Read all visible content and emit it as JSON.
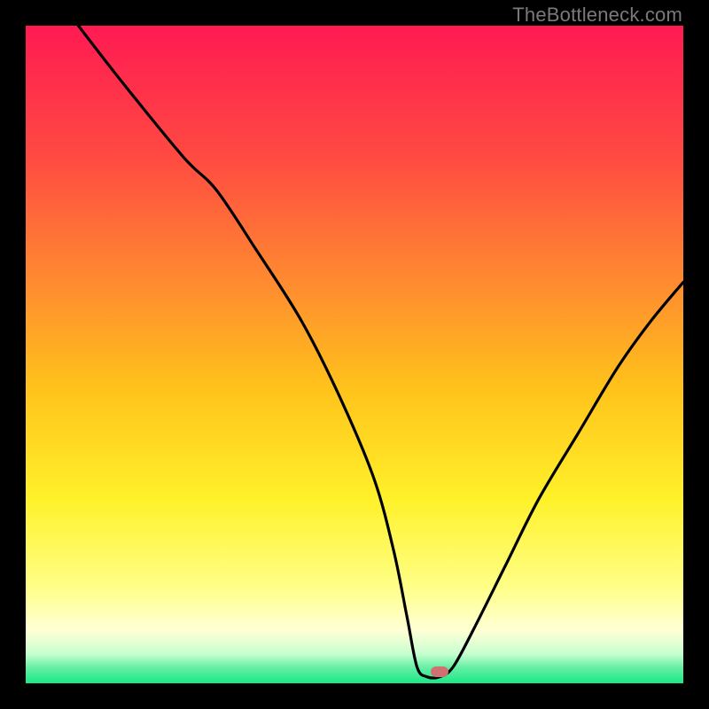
{
  "watermark": "TheBottleneck.com",
  "chart_data": {
    "type": "line",
    "title": "",
    "xlabel": "",
    "ylabel": "",
    "xlim": [
      0,
      100
    ],
    "ylim": [
      0,
      100
    ],
    "grid": false,
    "gradient_stops": [
      {
        "pos": 0.0,
        "color": "#ff1a52"
      },
      {
        "pos": 0.2,
        "color": "#ff4a42"
      },
      {
        "pos": 0.4,
        "color": "#ff8e2f"
      },
      {
        "pos": 0.55,
        "color": "#ffc21b"
      },
      {
        "pos": 0.72,
        "color": "#fff12a"
      },
      {
        "pos": 0.85,
        "color": "#ffff84"
      },
      {
        "pos": 0.92,
        "color": "#ffffd6"
      },
      {
        "pos": 0.955,
        "color": "#c8ffd0"
      },
      {
        "pos": 0.975,
        "color": "#6af0a6"
      },
      {
        "pos": 1.0,
        "color": "#18e886"
      }
    ],
    "series": [
      {
        "name": "curve",
        "x": [
          8,
          15,
          24,
          29,
          35,
          42,
          48,
          53,
          56,
          58,
          59.5,
          61,
          63,
          65,
          68,
          73,
          78,
          84,
          90,
          95,
          100
        ],
        "y": [
          100,
          91,
          80,
          75,
          66,
          55,
          43,
          31,
          20,
          10,
          2.5,
          1,
          1,
          2.5,
          8,
          18,
          28,
          38,
          48,
          55,
          61
        ]
      }
    ],
    "marker": {
      "x": 63,
      "y": 1.7,
      "color": "#cf7170"
    }
  }
}
